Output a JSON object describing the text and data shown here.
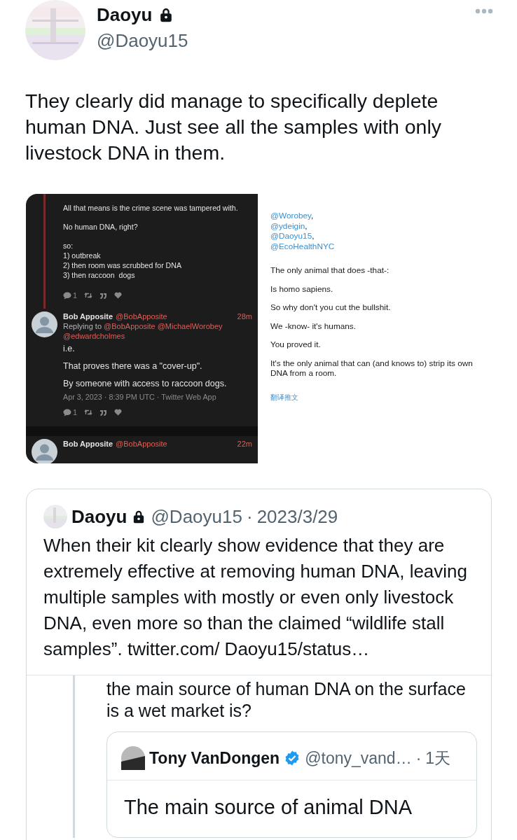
{
  "tweet": {
    "author": {
      "name": "Daoyu",
      "protected": true,
      "handle": "@Daoyu15"
    },
    "text": "They clearly did manage to specifically deplete human DNA. Just see all the samples with only livestock DNA in them.",
    "attached_screenshots": [
      {
        "kind": "dark_thread",
        "thread_paragraphs": [
          "All that means is the crime scene was tampered with.",
          "No human DNA, right?",
          "so:\n1) outbreak\n2) then room was scrubbed for DNA\n3) then raccoon  dogs"
        ],
        "thread_actions": [
          {
            "kind": "reply",
            "count": "1"
          },
          {
            "kind": "retweet"
          },
          {
            "kind": "quote"
          },
          {
            "kind": "like"
          }
        ],
        "replies": [
          {
            "name": "Bob Apposite",
            "handle": "@BobApposite",
            "time": "28m",
            "replying_label": "Replying to",
            "replying_handles": [
              "@BobApposite",
              "@MichaelWorobey",
              "@edwardcholmes"
            ],
            "paragraphs": [
              "i.e.",
              "That proves there was a \"cover-up\".",
              "By someone with access to raccoon dogs."
            ],
            "meta": "Apr 3, 2023 · 8:39 PM UTC · Twitter Web App",
            "actions": [
              {
                "kind": "reply",
                "count": "1"
              },
              {
                "kind": "retweet"
              },
              {
                "kind": "quote"
              },
              {
                "kind": "like"
              }
            ]
          },
          {
            "name": "Bob Apposite",
            "handle": "@BobApposite",
            "time": "22m"
          }
        ]
      },
      {
        "kind": "light_tweet",
        "mentions": [
          {
            "handle": "@Worobey",
            "separator": ","
          },
          {
            "handle": "@ydeigin",
            "separator": ","
          },
          {
            "handle": "@Daoyu15",
            "separator": ","
          },
          {
            "handle": "@EcoHealthNYC"
          }
        ],
        "paragraphs": [
          "The only animal that does -that-:",
          "Is homo sapiens.",
          "So why don't you cut the bullshit.",
          "We -know- it's humans.",
          "You proved it.",
          "It's the only animal that can (and knows to) strip its own DNA from a room."
        ],
        "translate_link": "翻译推文"
      }
    ],
    "quoted_tweet": {
      "author": {
        "name": "Daoyu",
        "protected": true,
        "handle": "@Daoyu15"
      },
      "separator": "·",
      "date": "2023/3/29",
      "text": "When their kit clearly show evidence that they are extremely effective at removing human DNA, leaving multiple samples with mostly or even only livestock DNA, even more so than the claimed “wildlife stall samples”. twitter.com/ Daoyu15/status…",
      "thread_text": "the main source of human DNA on the surface is a wet market is?",
      "quoted_tweet": {
        "author": {
          "name": "Tony VanDongen",
          "verified": true,
          "handle": "@tony_vand…"
        },
        "separator": "·",
        "date": "1天",
        "text": "The main source of animal DNA"
      }
    }
  }
}
